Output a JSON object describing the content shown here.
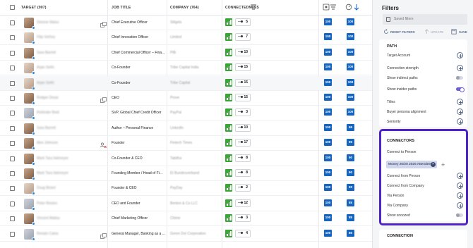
{
  "table": {
    "headers": {
      "target": "TARGET (907)",
      "job_title": "JOB TITLE",
      "company": "COMPANY (764)",
      "connectedness": "CONNECTEDNESS"
    },
    "rows": [
      {
        "name": "Simone Mainz",
        "title": "Chief Executive Officer",
        "company": "Stilgelo",
        "conn": "5",
        "score1": "100",
        "score2": "100",
        "icon": "network-icon"
      },
      {
        "name": "Filip Verhey",
        "title": "Chief Innovation Officer",
        "company": "Limited",
        "conn": "7",
        "score1": "100",
        "score2": "100",
        "icon": ""
      },
      {
        "name": "Sara Barrett",
        "title": "Chief Commercial Officer – Fina...",
        "company": "PIB",
        "conn": "10",
        "score1": "100",
        "score2": "100",
        "icon": ""
      },
      {
        "name": "Arjan Sethi",
        "title": "Co-Founder",
        "company": "Tribe Capital India",
        "conn": "15",
        "score1": "100",
        "score2": "100",
        "icon": ""
      },
      {
        "name": "Arjan Sethi",
        "title": "Co-Founder",
        "company": "Tribe Capital",
        "conn": "15",
        "score1": "100",
        "score2": "100",
        "icon": ""
      },
      {
        "name": "Rodger Desai",
        "title": "CEO",
        "company": "Prove",
        "conn": "15",
        "score1": "100",
        "score2": "100",
        "icon": "network-icon"
      },
      {
        "name": "Rohinder Bedi",
        "title": "SVP, Global Chief Credit Officer",
        "company": "PayPal",
        "conn": "3",
        "score1": "100",
        "score2": "100",
        "icon": ""
      },
      {
        "name": "Sara Barrett",
        "title": "Author – Personal Finance",
        "company": "LinkedIn",
        "conn": "10",
        "score1": "100",
        "score2": "95",
        "icon": ""
      },
      {
        "name": "Alex Johnson",
        "title": "Founder",
        "company": "Fintech Times",
        "conn": "17",
        "score1": "100",
        "score2": "95",
        "icon": "person-search-icon"
      },
      {
        "name": "Mark Tara Iwkmeyer",
        "title": "Co-Founder & CEO",
        "company": "Tabitha",
        "conn": "8",
        "score1": "100",
        "score2": "90",
        "icon": ""
      },
      {
        "name": "Mark Tara Iwkmeyer",
        "title": "Founding Member / Head of Fi...",
        "company": "EI Bundesverband",
        "conn": "8",
        "score1": "100",
        "score2": "90",
        "icon": ""
      },
      {
        "name": "Doug Bickel",
        "title": "Founder & CEO",
        "company": "PayDay",
        "conn": "2",
        "score1": "100",
        "score2": "90",
        "icon": ""
      },
      {
        "name": "Peter Reston",
        "title": "CEO and Founder",
        "company": "Benton & Co LLC",
        "conn": "12",
        "score1": "100",
        "score2": "85",
        "icon": ""
      },
      {
        "name": "Vincent Matias",
        "title": "Chief Marketing Officer",
        "company": "Chime",
        "conn": "3",
        "score1": "100",
        "score2": "85",
        "icon": ""
      },
      {
        "name": "Renato Caina",
        "title": "General Manager, Banking as a ...",
        "company": "Green Dot Corporation",
        "conn": "4",
        "score1": "100",
        "score2": "85",
        "icon": "network-icon"
      }
    ]
  },
  "filters": {
    "title": "Filters",
    "saved_placeholder": "Saved filters",
    "reset": "RESET FILTERS",
    "update": "UPDATE",
    "save": "SAVE",
    "path": {
      "label": "PATH",
      "target_account": "Target Account",
      "connection_strength": "Connection strength",
      "show_indirect": "Show indirect paths",
      "show_insider": "Show insider paths"
    },
    "titles": "Titles",
    "buyer_persona": "Buyer persona alignment",
    "seniority": "Seniority",
    "connectors": {
      "label": "CONNECTORS",
      "connect_to_person": "Connect to Person",
      "chip": "Money 20/20 2025 Attendees",
      "connect_from_person": "Connect from Person",
      "connect_from_company": "Connect from Company",
      "via_person": "Via Person",
      "via_company": "Via Company",
      "show_snoozed": "Show snoozed"
    },
    "connection": {
      "label": "CONNECTION"
    }
  },
  "colors": {
    "accent": "#4f23c9",
    "score_blue": "#1565c0",
    "conn_green": "#3aa635"
  }
}
